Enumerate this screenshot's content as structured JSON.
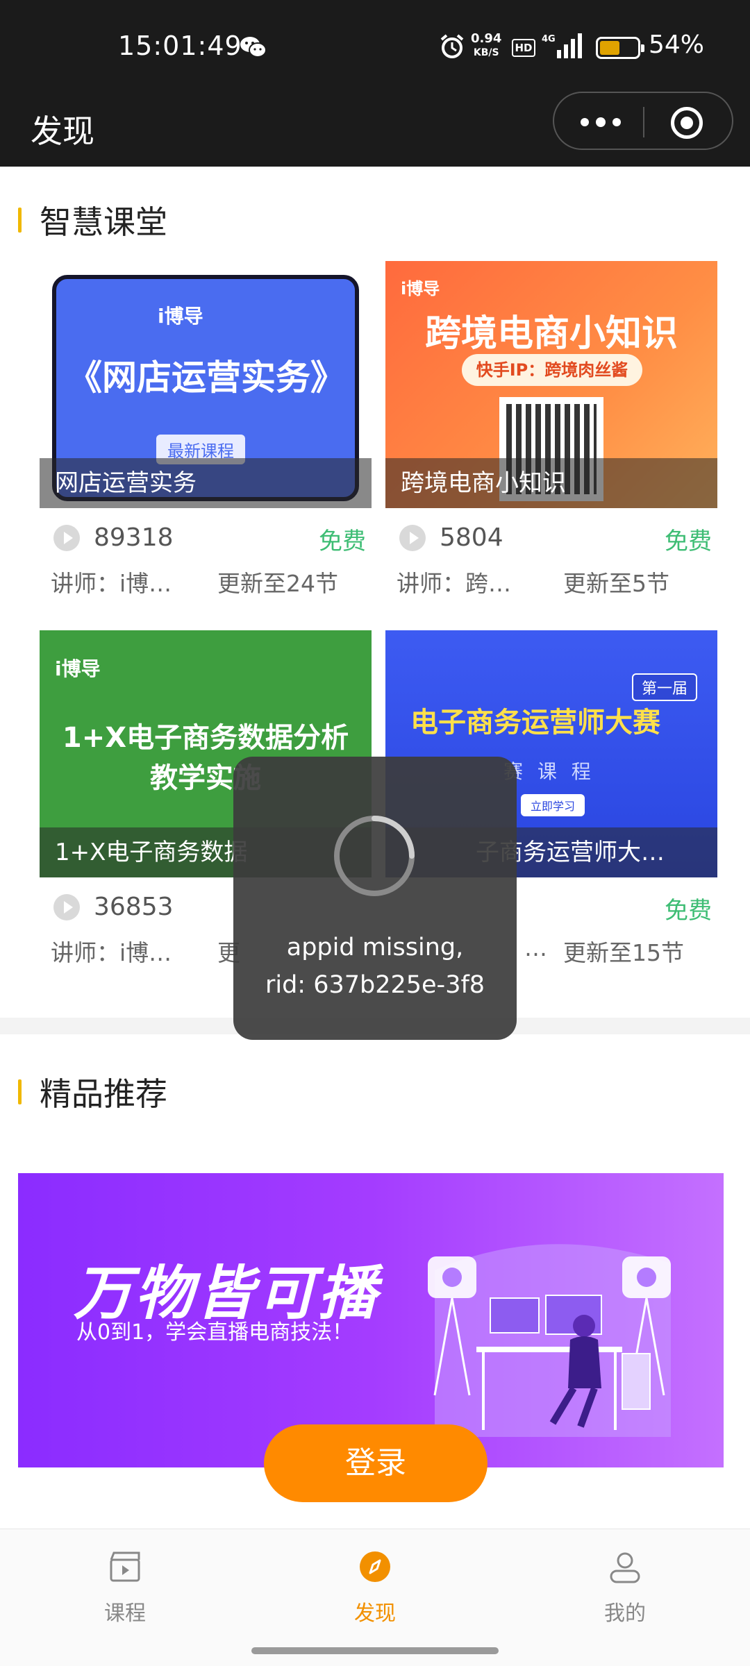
{
  "status_bar": {
    "time": "15:01:49",
    "net_speed_value": "0.94",
    "net_speed_unit": "KB/S",
    "hd_label": "HD",
    "signal_label": "4G",
    "battery_percent": "54%",
    "battery_level": 0.54,
    "icons": [
      "wechat-icon",
      "alarm-icon",
      "signal-icon",
      "battery-icon"
    ]
  },
  "nav": {
    "title": "发现",
    "more_icon": "more-dots-icon",
    "close_icon": "target-circle-icon"
  },
  "section1": {
    "title": "智慧课堂",
    "courses": [
      {
        "thumb_logo": "i博导",
        "thumb_title": "《网店运营实务》",
        "thumb_tag": "最新课程",
        "caption": "网店运营实务",
        "views": "89318",
        "price": "免费",
        "teacher": "讲师：i博…",
        "update": "更新至24节"
      },
      {
        "thumb_logo": "i博导",
        "thumb_title": "跨境电商小知识",
        "thumb_tag": "快手IP：跨境肉丝酱",
        "caption": "跨境电商小知识",
        "views": "5804",
        "price": "免费",
        "teacher": "讲师：跨…",
        "update": "更新至5节"
      },
      {
        "thumb_logo": "i博导",
        "thumb_title_line1": "1+X电子商务数据分析",
        "thumb_title_line2": "教学实施",
        "caption": "1+X电子商务数据",
        "views": "36853",
        "price": "",
        "teacher": "讲师：i博…",
        "update": "更"
      },
      {
        "thumb_title": "电子商务运营师大赛",
        "thumb_badge": "第一届",
        "thumb_sub": "赛 课 程",
        "thumb_btn": "立即学习",
        "caption": "子商务运营师大…",
        "views": "",
        "price": "免费",
        "teacher": "…",
        "update": "更新至15节"
      }
    ]
  },
  "section2": {
    "title": "精品推荐",
    "banner": {
      "headline": "万物皆可播",
      "subline": "从0到1，学会直播电商技法！"
    }
  },
  "login_button": "登录",
  "toast": {
    "line1": "appid missing,",
    "line2": "rid: 637b225e-3f8"
  },
  "tabs": [
    {
      "label": "课程",
      "icon": "clapperboard-icon",
      "active": false
    },
    {
      "label": "发现",
      "icon": "compass-icon",
      "active": true
    },
    {
      "label": "我的",
      "icon": "user-icon",
      "active": false
    }
  ],
  "colors": {
    "accent": "#f29000",
    "login": "#ff8a00",
    "free": "#3ebd74",
    "section_bar": "#f0b800"
  }
}
